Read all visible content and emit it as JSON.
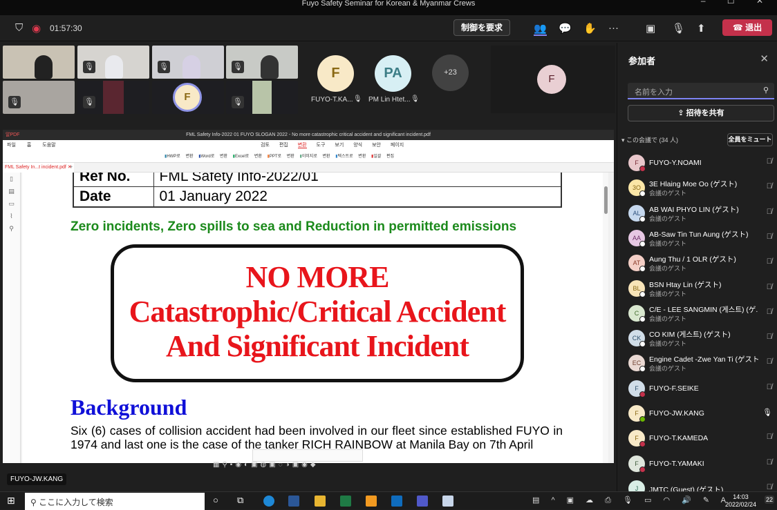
{
  "window": {
    "title": "Fuyo Safety Seminar for Korean & Myanmar Crews",
    "controls": "– ☐ ✕"
  },
  "meeting_bar": {
    "timer": "01:57:30",
    "request_control": "制御を要求",
    "leave": "退出"
  },
  "video": {
    "named_tiles": [
      {
        "initials": "F",
        "name": "FUYO-T.KA...",
        "color": "#f8e9c7",
        "text_color": "#8a6914"
      },
      {
        "initials": "PA",
        "name": "PM Lin Htet...",
        "color": "#d7eff4",
        "text_color": "#3c7d86"
      }
    ],
    "overflow": "+23",
    "spotlight_initials": "F",
    "speaker_initials": "F",
    "name_tag": "FUYO-JW.KANG"
  },
  "document": {
    "title": "FML Safety Info-2022 01 FUYO SLOGAN 2022 - No more catastrophic critical accident and significant incident.pdf",
    "app": "알PDF",
    "menu_left": [
      "파일",
      "홈",
      "도움말"
    ],
    "menu_center": [
      "검토",
      "편집",
      "변환",
      "도구",
      "보기",
      "양식",
      "보안",
      "페이지"
    ],
    "active_menu": "변환",
    "tools": [
      "HWP로 변환",
      "Word로 변환",
      "Excel로 변환",
      "PPT로 변환",
      "이미지로 변환",
      "텍스트로 변환",
      "일괄 편집"
    ],
    "tab": "FML Safety In...t incident.pdf",
    "ref_label": "Ref No.",
    "ref_value": "FML Safety Info-2022/01",
    "date_label": "Date",
    "date_value": "01 January 2022",
    "slogan": "Zero incidents, Zero spills to sea and Reduction in permitted emissions",
    "banner": [
      "NO MORE",
      "Catastrophic/Critical Accident",
      "And Significant Incident"
    ],
    "heading": "Background",
    "paragraph": "Six (6) cases of collision accident had been involved in our fleet since established FUYO in 1974 and last one is the case of the tanker RICH RAINBOW at Manila Bay on 7th April"
  },
  "panel": {
    "title": "参加者",
    "search_placeholder": "名前を入力",
    "invite": "招待を共有",
    "section": "この会議で (34 人)",
    "mute_all": "全員をミュート",
    "participants": [
      {
        "initials": "F",
        "name": "FUYO-Y.NOAMI",
        "sub": "",
        "bg": "#e9c7cb",
        "fg": "#7a2a35",
        "status": "busy",
        "mic": "muted"
      },
      {
        "initials": "3O",
        "name": "3E Hlaing Moe Oo (ゲスト)",
        "sub": "会議のゲスト",
        "bg": "#fbe6a6",
        "fg": "#8a6914",
        "status": "guest",
        "mic": "muted"
      },
      {
        "initials": "AL",
        "name": "AB WAI PHYO LIN (ゲスト)",
        "sub": "会議のゲスト",
        "bg": "#c6d8ee",
        "fg": "#2d4f7c",
        "status": "guest",
        "mic": "muted"
      },
      {
        "initials": "AA",
        "name": "AB-Saw Tin Tun Aung (ゲスト)",
        "sub": "会議のゲスト",
        "bg": "#e6c7e3",
        "fg": "#6d2d68",
        "status": "guest",
        "mic": "muted"
      },
      {
        "initials": "AT",
        "name": "Aung Thu / 1 OLR (ゲスト)",
        "sub": "会議のゲスト",
        "bg": "#f4cfc6",
        "fg": "#8a3a28",
        "status": "guest",
        "mic": "muted"
      },
      {
        "initials": "BL",
        "name": "BSN Htay Lin (ゲスト)",
        "sub": "会議のゲスト",
        "bg": "#f8e4b8",
        "fg": "#8a6914",
        "status": "guest",
        "mic": "muted"
      },
      {
        "initials": "C",
        "name": "C/E - LEE SANGMIN (게스트) (ゲ...",
        "sub": "会議のゲスト",
        "bg": "#d9e8cf",
        "fg": "#3e6a2a",
        "status": "guest",
        "mic": "muted"
      },
      {
        "initials": "CK",
        "name": "CO KIM (게스트) (ゲスト)",
        "sub": "会議のゲスト",
        "bg": "#d0dde8",
        "fg": "#2d4f6c",
        "status": "guest",
        "mic": "muted"
      },
      {
        "initials": "EC",
        "name": "Engine Cadet -Zwe Yan Ti (ゲスト)",
        "sub": "会議のゲスト",
        "bg": "#ead9d3",
        "fg": "#6d3d2d",
        "status": "guest",
        "mic": "muted"
      },
      {
        "initials": "F",
        "name": "FUYO-F.SEIKE",
        "sub": "",
        "bg": "#d0dde8",
        "fg": "#2d4f6c",
        "status": "busy",
        "mic": "muted"
      },
      {
        "initials": "F",
        "name": "FUYO-JW.KANG",
        "sub": "",
        "bg": "#f8e9c7",
        "fg": "#8a6914",
        "status": "available",
        "mic": "on"
      },
      {
        "initials": "F",
        "name": "FUYO-T.KAMEDA",
        "sub": "",
        "bg": "#f8e9c7",
        "fg": "#8a6914",
        "status": "busy",
        "mic": "muted"
      },
      {
        "initials": "F",
        "name": "FUYO-T.YAMAKI",
        "sub": "",
        "bg": "#dfe6dc",
        "fg": "#3e5a3a",
        "status": "busy",
        "mic": "muted"
      },
      {
        "initials": "J",
        "name": "JMTC (Guest) (ゲスト)",
        "sub": "",
        "bg": "#d9eee6",
        "fg": "#2d6a55",
        "status": "guest",
        "mic": "muted"
      }
    ]
  },
  "taskbar": {
    "search_placeholder": "ここに入力して検索",
    "time": "14:03",
    "date": "2022/02/24",
    "notifications": "22",
    "ime": "A"
  },
  "colors": {
    "leave": "#c4314b",
    "accent": "#7f85f5",
    "busy": "#c4314b",
    "available": "#6bb700"
  }
}
